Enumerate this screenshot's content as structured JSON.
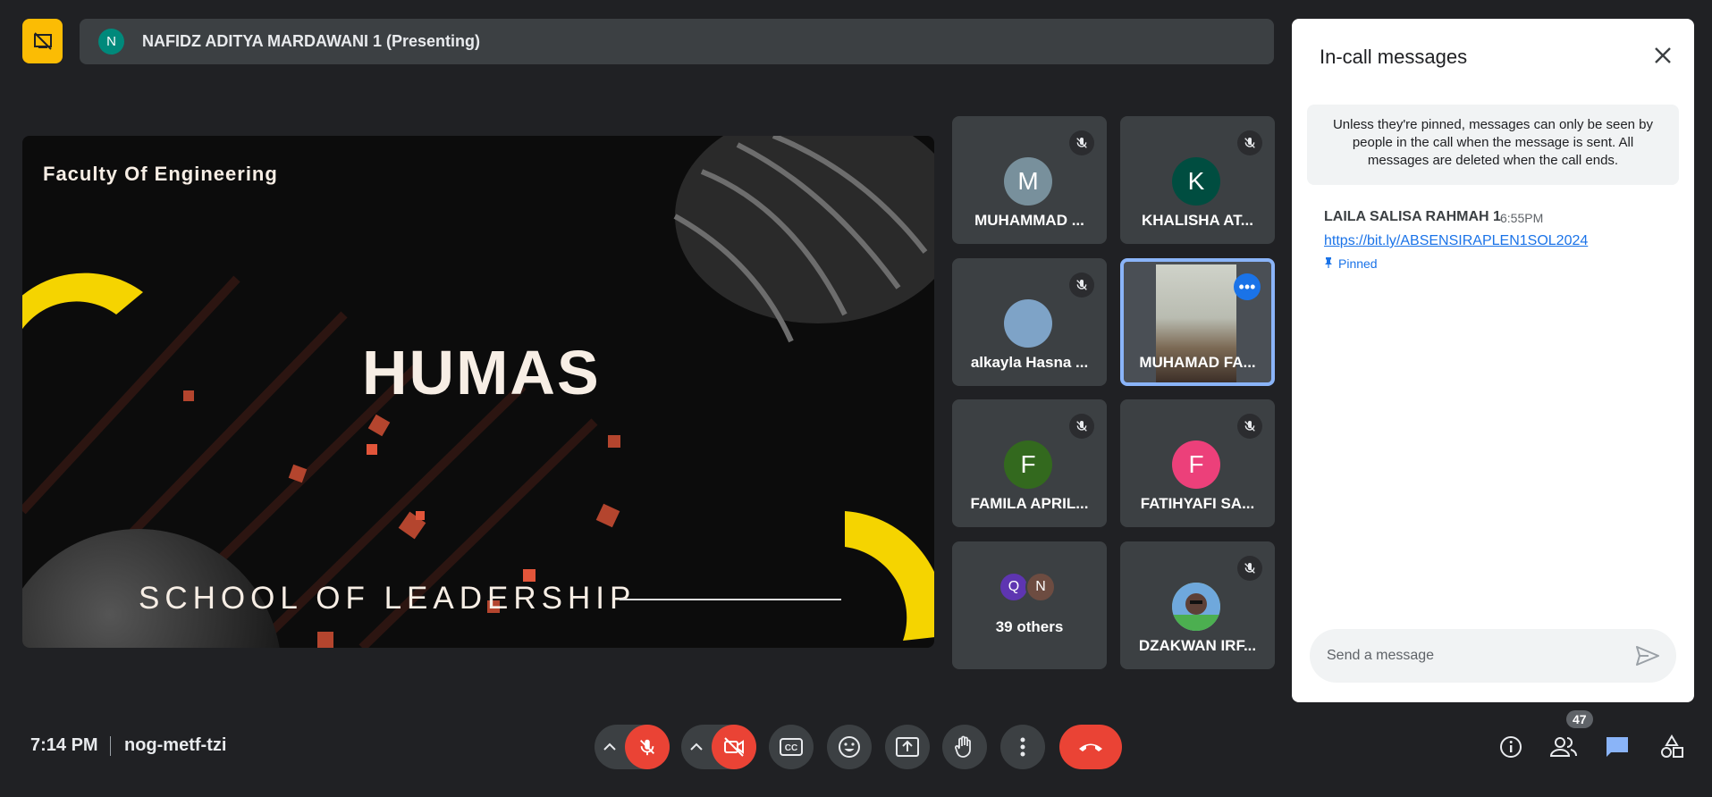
{
  "presenter": {
    "avatar_letter": "N",
    "name": "NAFIDZ ADITYA MARDAWANI 1 (Presenting)"
  },
  "slide": {
    "faculty": "Faculty Of Engineering",
    "title": "HUMAS",
    "subtitle": "SCHOOL OF LEADERSHIP"
  },
  "tiles": [
    {
      "letter": "M",
      "name": "MUHAMMAD ...",
      "color": "#78909c",
      "muted": true
    },
    {
      "letter": "K",
      "name": "KHALISHA AT...",
      "color": "#004d40",
      "muted": true
    },
    {
      "letter": "",
      "name": "alkayla Hasna ...",
      "color": "#7ea3c7",
      "muted": true
    },
    {
      "letter": "",
      "name": "MUHAMAD FA...",
      "color": "",
      "muted": false
    },
    {
      "letter": "F",
      "name": "FAMILA APRIL...",
      "color": "#33691e",
      "muted": true
    },
    {
      "letter": "F",
      "name": "FATIHYAFI SA...",
      "color": "#ec407a",
      "muted": true
    },
    {
      "letter": "",
      "name": "39 others",
      "color": "",
      "muted": false
    },
    {
      "letter": "",
      "name": "DZAKWAN IRF...",
      "color": "",
      "muted": true
    }
  ],
  "others_stack": [
    "Q",
    "N"
  ],
  "chat": {
    "title": "In-call messages",
    "notice": "Unless they're pinned, messages can only be seen by people in the call when the message is sent. All messages are deleted when the call ends.",
    "message": {
      "sender": "LAILA SALISA RAHMAH 1",
      "time": "6:55PM",
      "link": "https://bit.ly/ABSENSIRAPLEN1SOL2024",
      "pinned_label": "Pinned"
    },
    "input_placeholder": "Send a message"
  },
  "bottom": {
    "time": "7:14 PM",
    "meeting_code": "nog-metf-tzi",
    "participant_count": "47"
  },
  "colors": {
    "accent_red": "#ea4335",
    "accent_blue": "#1a73e8",
    "presenter_yellow": "#fbbc04"
  }
}
